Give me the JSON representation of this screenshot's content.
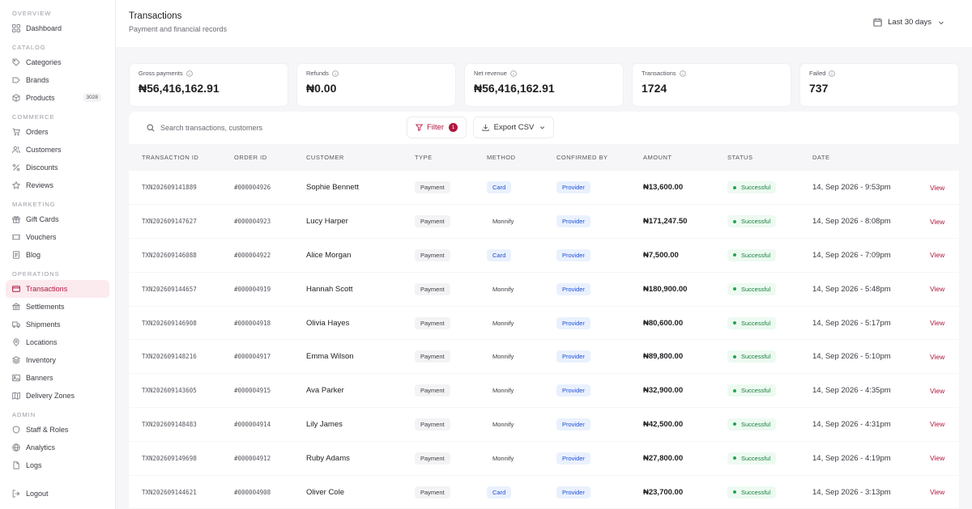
{
  "sidebar": {
    "sections": {
      "overview": "OVERVIEW",
      "catalog": "CATALOG",
      "commerce": "COMMERCE",
      "marketing": "MARKETING",
      "operations": "OPERATIONS",
      "admin": "ADMIN"
    },
    "items": {
      "dashboard": "Dashboard",
      "categories": "Categories",
      "brands": "Brands",
      "products": "Products",
      "products_badge": "3028",
      "orders": "Orders",
      "customers": "Customers",
      "discounts": "Discounts",
      "reviews": "Reviews",
      "gift_cards": "Gift Cards",
      "vouchers": "Vouchers",
      "blog": "Blog",
      "transactions": "Transactions",
      "settlements": "Settlements",
      "shipments": "Shipments",
      "locations": "Locations",
      "inventory": "Inventory",
      "banners": "Banners",
      "delivery_zones": "Delivery Zones",
      "staff_roles": "Staff & Roles",
      "analytics": "Analytics",
      "logs": "Logs",
      "logout": "Logout"
    }
  },
  "header": {
    "title": "Transactions",
    "subtitle": "Payment and financial records",
    "date_range": "Last 30 days"
  },
  "stats": [
    {
      "label": "Gross payments",
      "value": "₦56,416,162.91"
    },
    {
      "label": "Refunds",
      "value": "₦0.00"
    },
    {
      "label": "Net revenue",
      "value": "₦56,416,162.91"
    },
    {
      "label": "Transactions",
      "value": "1724"
    },
    {
      "label": "Failed",
      "value": "737"
    }
  ],
  "toolbar": {
    "search_placeholder": "Search transactions, customers",
    "filter_label": "Filter",
    "filter_count": "1",
    "export_label": "Export CSV"
  },
  "table": {
    "headers": [
      "TRANSACTION ID",
      "ORDER ID",
      "CUSTOMER",
      "TYPE",
      "METHOD",
      "CONFIRMED BY",
      "AMOUNT",
      "STATUS",
      "DATE"
    ],
    "view_label": "View",
    "rows": [
      {
        "txn": "TXN202609141889",
        "order": "#000004926",
        "customer": "Sophie Bennett",
        "type": "Payment",
        "method": "Card",
        "confirmed": "Provider",
        "amount": "₦13,600.00",
        "status": "Successful",
        "date": "14, Sep 2026 - 9:53pm"
      },
      {
        "txn": "TXN202609147627",
        "order": "#000004923",
        "customer": "Lucy Harper",
        "type": "Payment",
        "method": "Monnify",
        "confirmed": "Provider",
        "amount": "₦171,247.50",
        "status": "Successful",
        "date": "14, Sep 2026 - 8:08pm"
      },
      {
        "txn": "TXN202609146088",
        "order": "#000004922",
        "customer": "Alice Morgan",
        "type": "Payment",
        "method": "Card",
        "confirmed": "Provider",
        "amount": "₦7,500.00",
        "status": "Successful",
        "date": "14, Sep 2026 - 7:09pm"
      },
      {
        "txn": "TXN202609144657",
        "order": "#000004919",
        "customer": "Hannah Scott",
        "type": "Payment",
        "method": "Monnify",
        "confirmed": "Provider",
        "amount": "₦180,900.00",
        "status": "Successful",
        "date": "14, Sep 2026 - 5:48pm"
      },
      {
        "txn": "TXN202609146908",
        "order": "#000004918",
        "customer": "Olivia Hayes",
        "type": "Payment",
        "method": "Monnify",
        "confirmed": "Provider",
        "amount": "₦80,600.00",
        "status": "Successful",
        "date": "14, Sep 2026 - 5:17pm"
      },
      {
        "txn": "TXN202609148216",
        "order": "#000004917",
        "customer": "Emma Wilson",
        "type": "Payment",
        "method": "Monnify",
        "confirmed": "Provider",
        "amount": "₦89,800.00",
        "status": "Successful",
        "date": "14, Sep 2026 - 5:10pm"
      },
      {
        "txn": "TXN202609143605",
        "order": "#000004915",
        "customer": "Ava Parker",
        "type": "Payment",
        "method": "Monnify",
        "confirmed": "Provider",
        "amount": "₦32,900.00",
        "status": "Successful",
        "date": "14, Sep 2026 - 4:35pm"
      },
      {
        "txn": "TXN202609148483",
        "order": "#000004914",
        "customer": "Lily James",
        "type": "Payment",
        "method": "Monnify",
        "confirmed": "Provider",
        "amount": "₦42,500.00",
        "status": "Successful",
        "date": "14, Sep 2026 - 4:31pm"
      },
      {
        "txn": "TXN202609149698",
        "order": "#000004912",
        "customer": "Ruby Adams",
        "type": "Payment",
        "method": "Monnify",
        "confirmed": "Provider",
        "amount": "₦27,800.00",
        "status": "Successful",
        "date": "14, Sep 2026 - 4:19pm"
      },
      {
        "txn": "TXN202609144621",
        "order": "#000004908",
        "customer": "Oliver Cole",
        "type": "Payment",
        "method": "Card",
        "confirmed": "Provider",
        "amount": "₦23,700.00",
        "status": "Successful",
        "date": "14, Sep 2026 - 3:13pm"
      }
    ]
  },
  "colors": {
    "accent": "#b0173f",
    "active_bg": "#fbeaee",
    "success": "#15803d",
    "success_bg": "#edfaf1",
    "info": "#1d4ed8",
    "info_bg": "#eaf1fe",
    "panel_bg": "#f6f6f8"
  }
}
